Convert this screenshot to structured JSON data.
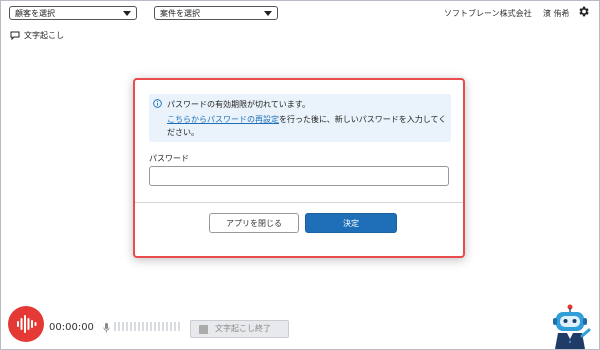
{
  "topbar": {
    "customer_select": "顧客を選択",
    "project_select": "案件を選択",
    "company": "ソフトブレーン株式会社",
    "user": "濱 侑希"
  },
  "sidebar": {
    "transcribe_label": "文字起こし"
  },
  "dialog": {
    "notice_line1": "パスワードの有効期限が切れています。",
    "notice_link": "こちらからパスワードの再設定",
    "notice_rest": "を行った後に、新しいパスワードを入力してください。",
    "password_label": "パスワード",
    "password_value": "",
    "close_button": "アプリを閉じる",
    "ok_button": "決定"
  },
  "bottombar": {
    "timer": "00:00:00",
    "end_button": "文字起こし終了"
  },
  "colors": {
    "dialog_border": "#e94c4c",
    "primary": "#1f6fb8",
    "mic": "#e53935"
  }
}
